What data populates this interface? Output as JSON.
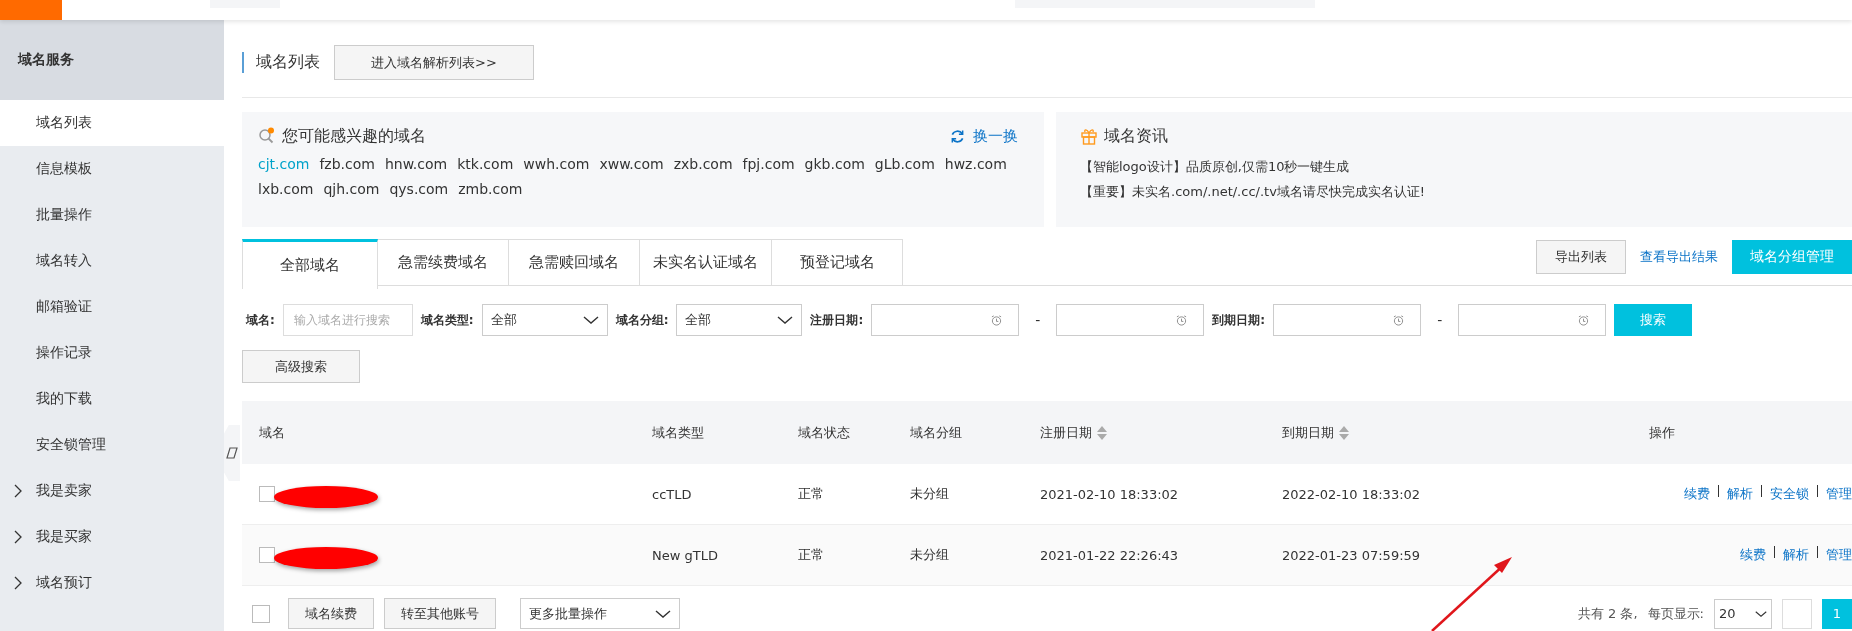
{
  "sidebar": {
    "header": "域名服务",
    "items": [
      {
        "label": "域名列表",
        "kind": "link",
        "selected": true
      },
      {
        "label": "信息模板",
        "kind": "link",
        "selected": false
      },
      {
        "label": "批量操作",
        "kind": "link",
        "selected": false
      },
      {
        "label": "域名转入",
        "kind": "link",
        "selected": false
      },
      {
        "label": "邮箱验证",
        "kind": "link",
        "selected": false
      },
      {
        "label": "操作记录",
        "kind": "link",
        "selected": false
      },
      {
        "label": "我的下载",
        "kind": "link",
        "selected": false
      },
      {
        "label": "安全锁管理",
        "kind": "link",
        "selected": false
      },
      {
        "label": "我是卖家",
        "kind": "group",
        "selected": false
      },
      {
        "label": "我是买家",
        "kind": "group",
        "selected": false
      },
      {
        "label": "域名预订",
        "kind": "group",
        "selected": false
      }
    ]
  },
  "page_title": "域名列表",
  "resolve_button": "进入域名解析列表>>",
  "suggest": {
    "title": "您可能感兴趣的域名",
    "refresh": "换一换",
    "domains": [
      {
        "name": "cjt.com",
        "selected": true
      },
      {
        "name": "fzb.com",
        "selected": false
      },
      {
        "name": "hnw.com",
        "selected": false
      },
      {
        "name": "ktk.com",
        "selected": false
      },
      {
        "name": "wwh.com",
        "selected": false
      },
      {
        "name": "xww.com",
        "selected": false
      },
      {
        "name": "zxb.com",
        "selected": false
      },
      {
        "name": "fpj.com",
        "selected": false
      },
      {
        "name": "gkb.com",
        "selected": false
      },
      {
        "name": "gLb.com",
        "selected": false
      },
      {
        "name": "hwz.com",
        "selected": false
      },
      {
        "name": "lxb.com",
        "selected": false
      },
      {
        "name": "qjh.com",
        "selected": false
      },
      {
        "name": "qys.com",
        "selected": false
      },
      {
        "name": "zmb.com",
        "selected": false
      }
    ]
  },
  "news": {
    "title": "域名资讯",
    "items": [
      "【智能logo设计】品质原创,仅需10秒一键生成",
      "【重要】未实名.com/.net/.cc/.tv域名请尽快完成实名认证!"
    ]
  },
  "tabs": [
    {
      "label": "全部域名",
      "selected": true
    },
    {
      "label": "急需续费域名",
      "selected": false
    },
    {
      "label": "急需赎回域名",
      "selected": false
    },
    {
      "label": "未实名认证域名",
      "selected": false
    },
    {
      "label": "预登记域名",
      "selected": false
    }
  ],
  "export_button": "导出列表",
  "export_link": "查看导出结果",
  "group_button": "域名分组管理",
  "filters": {
    "domain_label": "域名:",
    "domain_placeholder": "输入域名进行搜索",
    "type_label": "域名类型:",
    "type_value": "全部",
    "group_label": "域名分组:",
    "group_value": "全部",
    "reg_label": "注册日期:",
    "exp_label": "到期日期:",
    "range_sep": [
      "-",
      "-"
    ],
    "search_button": "搜索",
    "advanced_button": "高级搜索"
  },
  "table": {
    "columns": [
      {
        "label": "域名",
        "sortable": false
      },
      {
        "label": "域名类型",
        "sortable": false
      },
      {
        "label": "域名状态",
        "sortable": false
      },
      {
        "label": "域名分组",
        "sortable": false
      },
      {
        "label": "注册日期",
        "sortable": true
      },
      {
        "label": "到期日期",
        "sortable": true
      },
      {
        "label": "操作",
        "sortable": false
      }
    ],
    "rows": [
      {
        "checked": false,
        "type": "ccTLD",
        "status": "正常",
        "group": "未分组",
        "registered": "2021-02-10 18:33:02",
        "expires": "2022-02-10 18:33:02",
        "actions": [
          "续费",
          "解析",
          "安全锁",
          "管理"
        ]
      },
      {
        "checked": false,
        "type": "New gTLD",
        "status": "正常",
        "group": "未分组",
        "registered": "2021-01-22 22:26:43",
        "expires": "2022-01-23 07:59:59",
        "actions": [
          "续费",
          "解析",
          "管理"
        ]
      }
    ]
  },
  "footer": {
    "checked": false,
    "buttons": [
      "域名续费",
      "转至其他账号"
    ],
    "batch": "更多批量操作",
    "total": "共有 2 条,",
    "per_page_label": "每页显示:",
    "per_page": "20",
    "pages": [
      {
        "label": "1",
        "selected": true
      }
    ]
  }
}
